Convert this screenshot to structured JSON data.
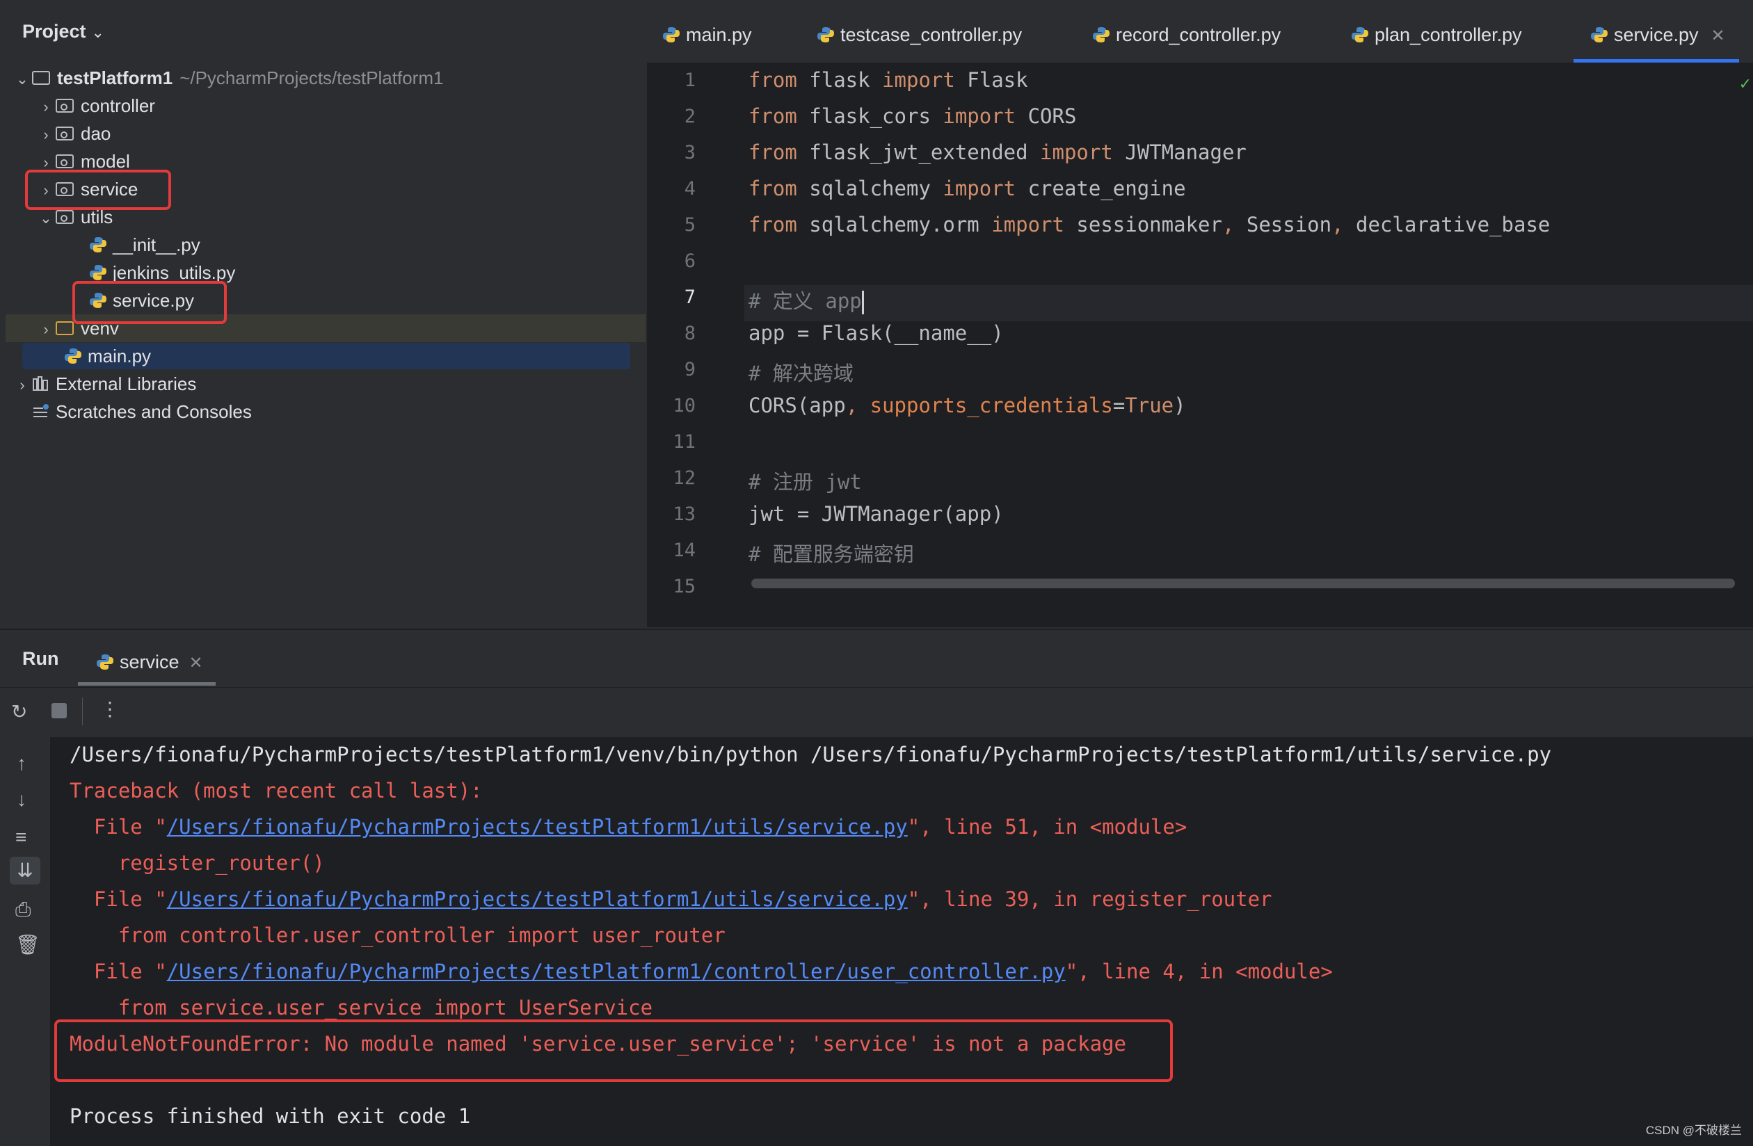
{
  "project": {
    "header": "Project",
    "root_name": "testPlatform1",
    "root_path": "~/PycharmProjects/testPlatform1",
    "items": [
      {
        "label": "controller"
      },
      {
        "label": "dao"
      },
      {
        "label": "model"
      },
      {
        "label": "service"
      },
      {
        "label": "utils"
      },
      {
        "label": "__init__.py"
      },
      {
        "label": "jenkins_utils.py"
      },
      {
        "label": "service.py"
      },
      {
        "label": "venv"
      },
      {
        "label": "main.py"
      },
      {
        "label": "External Libraries"
      },
      {
        "label": "Scratches and Consoles"
      }
    ]
  },
  "editor": {
    "tabs": [
      {
        "label": "main.py"
      },
      {
        "label": "testcase_controller.py"
      },
      {
        "label": "record_controller.py"
      },
      {
        "label": "plan_controller.py"
      },
      {
        "label": "service.py",
        "active": true
      }
    ],
    "line_numbers": [
      "1",
      "2",
      "3",
      "4",
      "5",
      "6",
      "7",
      "8",
      "9",
      "10",
      "11",
      "12",
      "13",
      "14",
      "15"
    ],
    "current_line": 7,
    "lines": {
      "l1": {
        "k1": "from",
        "a": " flask ",
        "k2": "import",
        "b": " Flask"
      },
      "l2": {
        "k1": "from",
        "a": " flask_cors ",
        "k2": "import",
        "b": " CORS"
      },
      "l3": {
        "k1": "from",
        "a": " flask_jwt_extended ",
        "k2": "import",
        "b": " JWTManager"
      },
      "l4": {
        "k1": "from",
        "a": " sqlalchemy ",
        "k2": "import",
        "b": " create_engine"
      },
      "l5": {
        "k1": "from",
        "a": " sqlalchemy.orm ",
        "k2": "import",
        "b": " sessionmaker",
        "c1": ",",
        "c": " Session",
        "c2": ",",
        "d": " declarative_base"
      },
      "l7": "# 定义 app",
      "l8": "app = Flask(__name__)",
      "l9": "# 解决跨域",
      "l10": {
        "a": "CORS(app",
        "c1": ", ",
        "p": "supports_credentials",
        "eq": "=",
        "kw": "True",
        "e": ")"
      },
      "l12": "# 注册 jwt",
      "l13": "jwt = JWTManager(app)",
      "l14": "# 配置服务端密钥"
    }
  },
  "run": {
    "title": "Run",
    "tab_label": "service",
    "console": {
      "cmd": "/Users/fionafu/PycharmProjects/testPlatform1/venv/bin/python /Users/fionafu/PycharmProjects/testPlatform1/utils/service.py",
      "traceback": "Traceback (most recent call last):",
      "f1_pre": "  File \"",
      "f1_link": "/Users/fionafu/PycharmProjects/testPlatform1/utils/service.py",
      "f1_post": "\", line 51, in <module>",
      "f1_code": "    register_router()",
      "f2_pre": "  File \"",
      "f2_link": "/Users/fionafu/PycharmProjects/testPlatform1/utils/service.py",
      "f2_post": "\", line 39, in register_router",
      "f2_code": "    from controller.user_controller import user_router",
      "f3_pre": "  File \"",
      "f3_link": "/Users/fionafu/PycharmProjects/testPlatform1/controller/user_controller.py",
      "f3_post": "\", line 4, in <module>",
      "f3_code": "    from service.user_service import UserService",
      "error": "ModuleNotFoundError: No module named 'service.user_service'; 'service' is not a package",
      "exit": "Process finished with exit code 1"
    }
  },
  "watermark": "CSDN @不破楼兰",
  "colors": {
    "error": "#ec5f59",
    "link": "#548af7",
    "highlight_box": "#e23b3b",
    "keyword": "#cf8e6d",
    "accent": "#3574f0"
  }
}
